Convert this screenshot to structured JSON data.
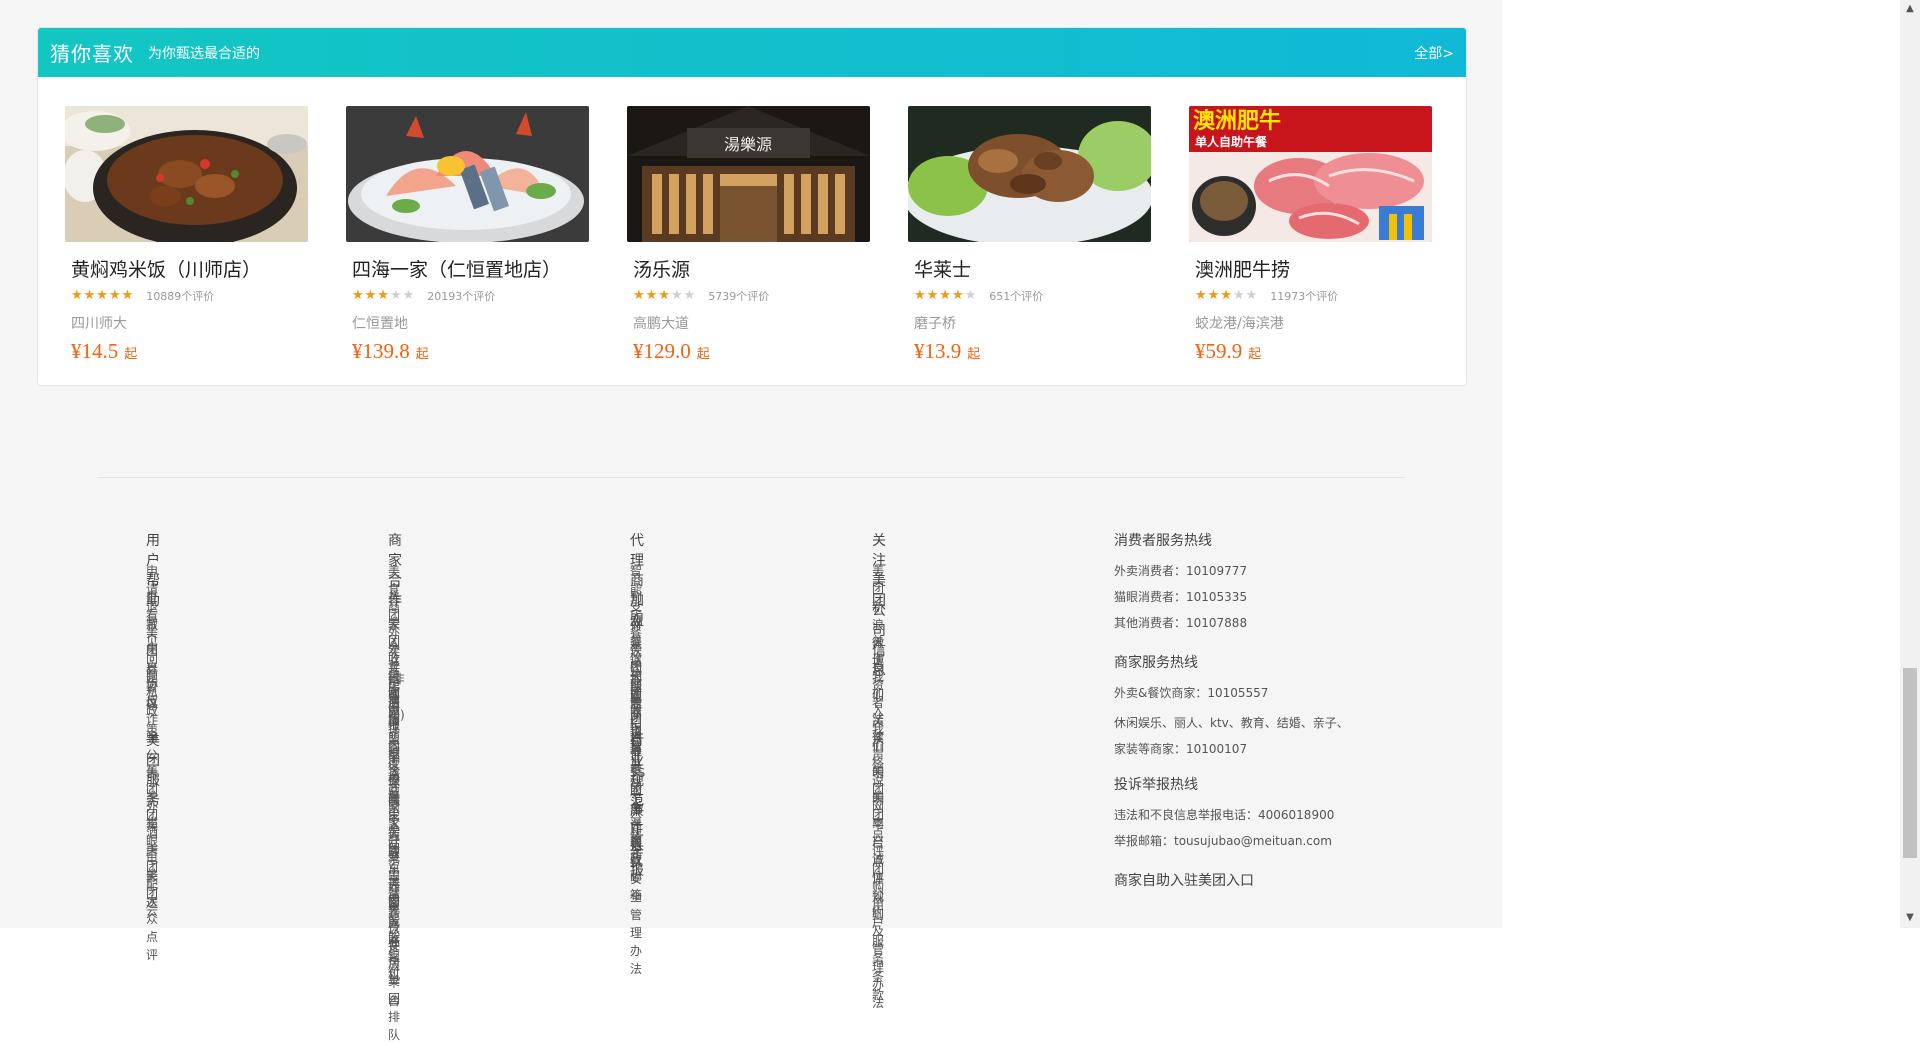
{
  "recommend": {
    "title": "猜你喜欢",
    "subtitle": "为你甄选最合适的",
    "all_link": "全部>",
    "items": [
      {
        "name": "黄焖鸡米饭（川师店）",
        "stars": 5,
        "reviews": "10889个评价",
        "area": "四川师大",
        "price": "¥14.5",
        "qi": "起"
      },
      {
        "name": "四海一家（仁恒置地店）",
        "stars": 3,
        "reviews": "20193个评价",
        "area": "仁恒置地",
        "price": "¥139.8",
        "qi": "起"
      },
      {
        "name": "汤乐源",
        "stars": 3,
        "reviews": "5739个评价",
        "area": "高鹏大道",
        "price": "¥129.0",
        "qi": "起"
      },
      {
        "name": "华莱士",
        "stars": 4,
        "reviews": "651个评价",
        "area": "磨子桥",
        "price": "¥13.9",
        "qi": "起"
      },
      {
        "name": "澳洲肥牛捞",
        "stars": 3,
        "reviews": "11973个评价",
        "area": "蛟龙港/海滨港",
        "price": "¥59.9",
        "qi": "起"
      }
    ],
    "image_texts": {
      "tangleyuan_sign": "湯樂源",
      "aozhou_banner": "澳洲肥牛",
      "aozhou_banner_sub": "单人自助午餐"
    }
  },
  "footer": {
    "help": {
      "title": "用户帮助",
      "links": [
        "申请退款",
        "查看美团券密码",
        "常见问题",
        "用户协议",
        "隐私政策",
        "反诈骗公告"
      ]
    },
    "service": {
      "title": "美团服务",
      "links": [
        "美团外卖",
        "美团酒店",
        "猫眼电影",
        "美团配送",
        "美团云",
        "大众点评"
      ]
    },
    "merchant": {
      "title": "商家合作",
      "links": [
        "美食商家入驻(非外卖)",
        "美团外卖开店申请",
        "美团收银官网",
        "外卖配送加盟申请",
        "美团点评餐饮学院",
        "酒店商家入驻",
        "境内度假商家入驻",
        "综合商家入驻",
        "榛果民宿房东商家入驻",
        "商家开票申请",
        "美团点评智能收银机",
        "聚宝盆餐饮开放平台",
        "美团智能支付",
        "免费使用美团排队"
      ]
    },
    "agent": {
      "title": "代理商加盟",
      "links": [
        "智能支付渠道加盟商招募",
        "到店餐饮代理商招募",
        "非餐饮代理商招募",
        "美团联盟",
        "美团收银招募线上分销商",
        "美团点评5S服务商招募"
      ]
    },
    "industry": {
      "title": "行业规范",
      "links": [
        "美团点评餐饮安全管理办法"
      ]
    },
    "integrity": {
      "title": "廉正举报",
      "links": [
        "廉政邮箱"
      ]
    },
    "follow": {
      "title": "关注美团",
      "links": [
        "美团新浪微博"
      ]
    },
    "company": {
      "title": "公司信息",
      "links": [
        "关于我们",
        "投资者关系",
        "加入我们",
        "法律声明",
        "价格说明",
        "美团网平台点评规则",
        "美团点评团购用户服务条款",
        "商户诚信公约及管理办法"
      ]
    },
    "consumer_hotline": {
      "title": "消费者服务热线",
      "lines": [
        "外卖消费者：10109777",
        "猫眼消费者：10105335",
        "其他消费者：10107888"
      ]
    },
    "merchant_hotline": {
      "title": "商家服务热线",
      "lines": [
        "外卖&餐饮商家：10105557",
        "休闲娱乐、丽人、ktv、教育、结婚、亲子、家装等商家：10100107"
      ]
    },
    "complaint_hotline": {
      "title": "投诉举报热线",
      "lines": [
        "违法和不良信息举报电话：4006018900",
        "举报邮箱：tousujubao@meituan.com"
      ]
    },
    "self_entry": {
      "title": "商家自助入驻美团入口"
    }
  },
  "colors": {
    "header_gradient_start": "#13c6c2",
    "header_gradient_end": "#11b9d6",
    "price": "#f2620f",
    "star": "#ef9b12"
  }
}
